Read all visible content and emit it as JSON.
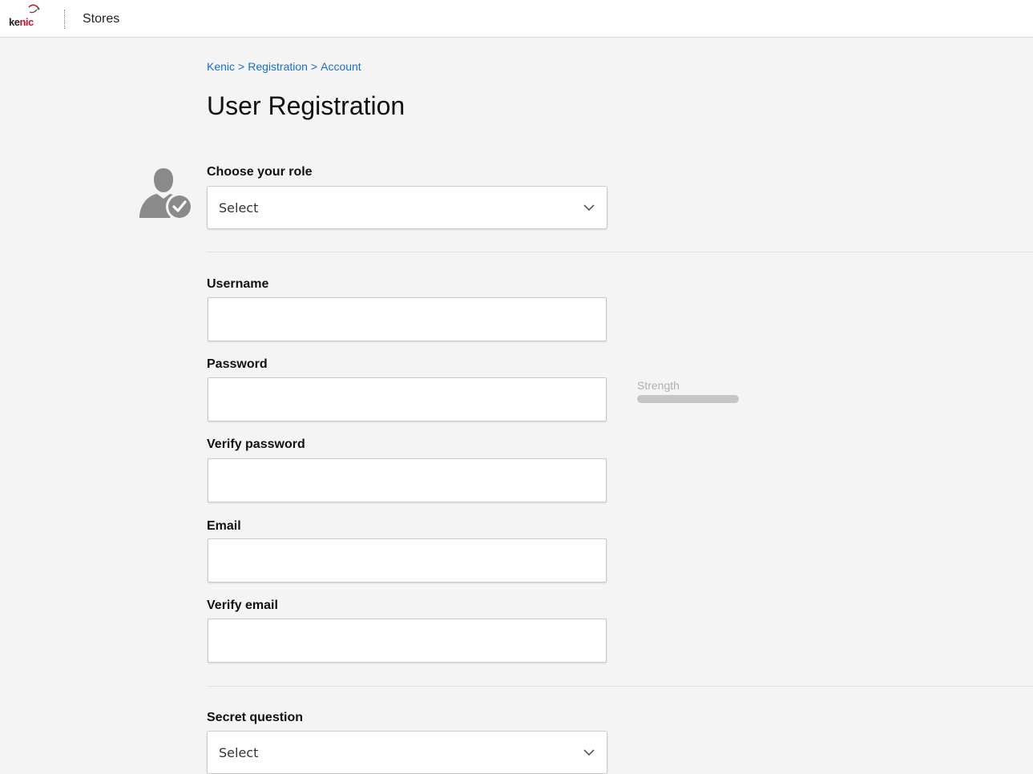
{
  "header": {
    "logo_text_ke": "ke",
    "logo_text_nic": "nic",
    "nav_stores": "Stores"
  },
  "breadcrumb": {
    "items": [
      "Kenic",
      "Registration",
      "Account"
    ],
    "separator": ">"
  },
  "page": {
    "title": "User Registration"
  },
  "form": {
    "role": {
      "label": "Choose your role",
      "selected": "Select"
    },
    "username": {
      "label": "Username",
      "value": ""
    },
    "password": {
      "label": "Password",
      "value": ""
    },
    "verify_password": {
      "label": "Verify password",
      "value": ""
    },
    "email": {
      "label": "Email",
      "value": ""
    },
    "verify_email": {
      "label": "Verify email",
      "value": ""
    },
    "secret_question": {
      "label": "Secret question",
      "selected": "Select"
    },
    "strength": {
      "label": "Strength",
      "level": 0
    }
  },
  "icons": {
    "role_icon": "user-check-icon",
    "chevron": "chevron-down-icon",
    "logo": "kenic-logo"
  },
  "colors": {
    "link": "#1a6fc4",
    "background": "#f4f4f4",
    "icon_gray": "#8a8a8a",
    "logo_red": "#c8102e"
  }
}
